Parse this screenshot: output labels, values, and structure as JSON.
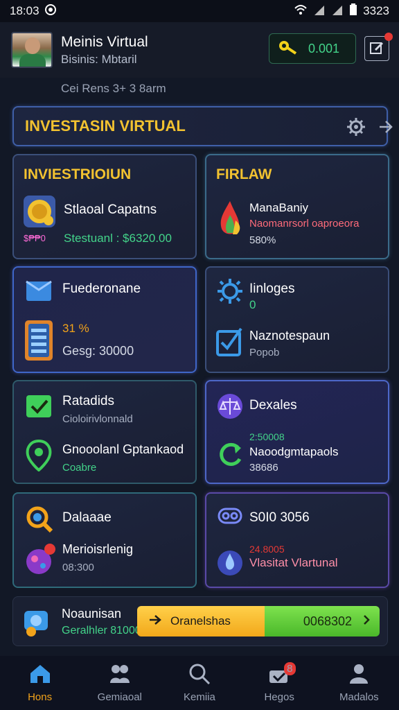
{
  "status_bar": {
    "time": "18:03",
    "right_value": "3323"
  },
  "header": {
    "user_name": "Meinis Virtual",
    "user_sub": "Bisinis: Mbtaril",
    "coin_value": "0.001"
  },
  "subtitle": "Cei Rens 3+ 3 8arm",
  "banner": {
    "title": "INVESTASIN VIRTUAL"
  },
  "cards": [
    {
      "title": "INVIESTRIOIUN",
      "title_color": "#f2c230",
      "line1": "Stlaoal Capatns",
      "line2": "Stestuanl : $6320.00",
      "line2_color": "#43d48a",
      "tag": "$₱₱0"
    },
    {
      "title": "FIRLAW",
      "title_color": "#f2c230",
      "line1": "ManaBaniy",
      "line2": "Naomanrsorl oaproeora",
      "line2_color": "#ff6b7a",
      "line3": "580%"
    },
    {
      "title": "Fuederonane",
      "line1": "31 %",
      "line1_color": "#f2a31a",
      "line2": "Gesg: 30000"
    },
    {
      "title": "Iinloges",
      "line1": "0",
      "line1_color": "#43d48a",
      "line2": "Naznotespaun",
      "line3": "Popob"
    },
    {
      "title": "Ratadids",
      "line1": "Cioloirivlonnald",
      "line2": "Gnooolanl Gptankaod",
      "line3": "Coabre",
      "line3_color": "#43d48a"
    },
    {
      "title": "Dexales",
      "line1": "2:50008",
      "line1_color": "#43d48a",
      "line2": "Naoodgmtapaols",
      "line3": "38686"
    },
    {
      "title": "Dalaaae",
      "line1": "Merioisrlenig",
      "line2": "08:300"
    },
    {
      "title": "S0I0 3056",
      "line1": "24.8005",
      "line1_color": "#e53935",
      "line2": "Vlasitat Vlartunal",
      "line2_color": "#ff8fa8"
    }
  ],
  "bottom": {
    "line1": "Noaunisan",
    "line2": "Geralhler 81000",
    "cta_left": "Oranelshas",
    "cta_right": "0068302"
  },
  "nav": [
    {
      "label": "Hons",
      "icon": "home-icon",
      "active": true
    },
    {
      "label": "Gemiaoal",
      "icon": "people-icon"
    },
    {
      "label": "Kemiia",
      "icon": "search-icon"
    },
    {
      "label": "Hegos",
      "icon": "gift-icon",
      "badge": "8"
    },
    {
      "label": "Madalos",
      "icon": "profile-icon"
    }
  ],
  "colors": {
    "accent_gold": "#f2c230",
    "accent_green": "#43d48a",
    "nav_active": "#f2a31a"
  }
}
